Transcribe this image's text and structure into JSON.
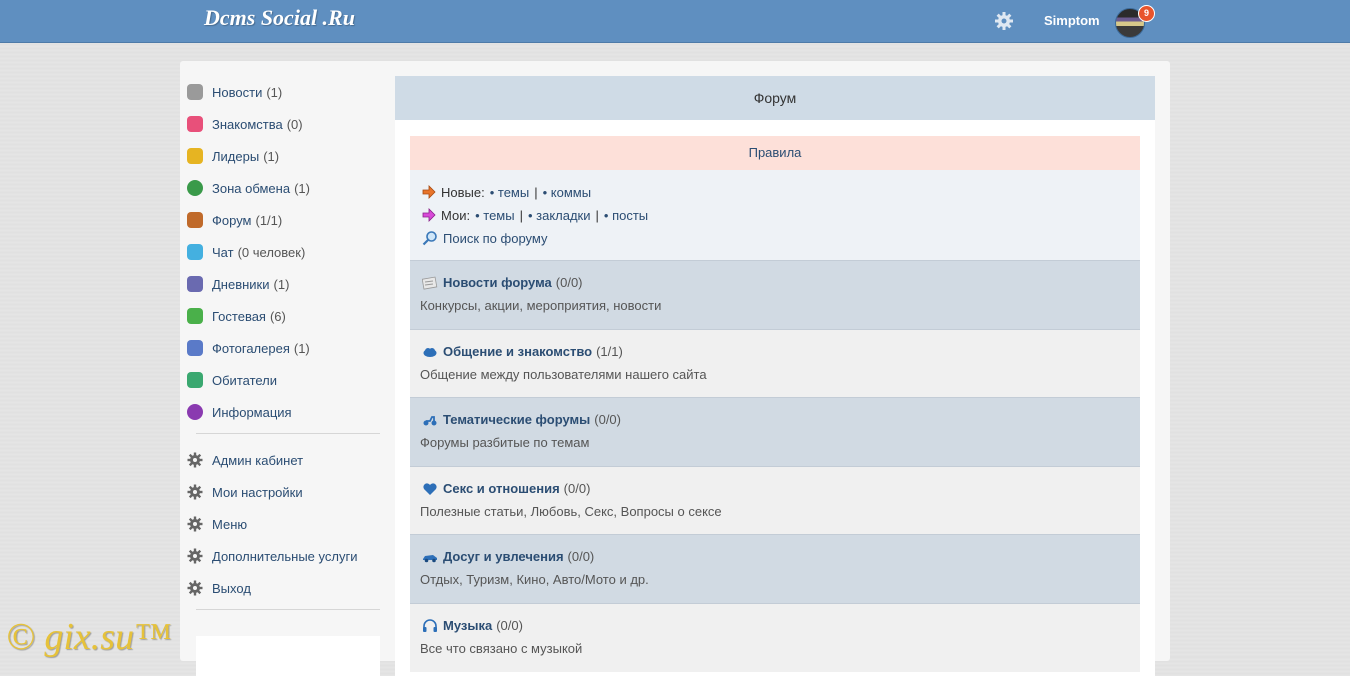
{
  "header": {
    "logo": "Dcms Social .Ru",
    "username": "Simptom",
    "notification_count": "9"
  },
  "sidebar": {
    "items": [
      {
        "label": "Новости",
        "count": "(1)",
        "icon": "news-icon",
        "color": "#9a9a9a"
      },
      {
        "label": "Знакомства",
        "count": "(0)",
        "icon": "heart-icon",
        "color": "#e8507a"
      },
      {
        "label": "Лидеры",
        "count": "(1)",
        "icon": "trophy-icon",
        "color": "#e6b422"
      },
      {
        "label": "Зона обмена",
        "count": "(1)",
        "icon": "exchange-icon",
        "color": "#3a9a4a"
      },
      {
        "label": "Форум",
        "count": "(1/1)",
        "icon": "forum-icon",
        "color": "#c06a2a"
      },
      {
        "label": "Чат",
        "count": "(0 человек)",
        "icon": "chat-icon",
        "color": "#44b0e0"
      },
      {
        "label": "Дневники",
        "count": "(1)",
        "icon": "diary-icon",
        "color": "#6a6ab0"
      },
      {
        "label": "Гостевая",
        "count": "(6)",
        "icon": "guestbook-icon",
        "color": "#4ab04a"
      },
      {
        "label": "Фотогалерея",
        "count": "(1)",
        "icon": "photo-icon",
        "color": "#5a7ac8"
      },
      {
        "label": "Обитатели",
        "count": "",
        "icon": "users-icon",
        "color": "#3aa870"
      },
      {
        "label": "Информация",
        "count": "",
        "icon": "info-icon",
        "color": "#8a3ab0"
      }
    ],
    "settings": [
      {
        "label": "Админ кабинет"
      },
      {
        "label": "Мои настройки"
      },
      {
        "label": "Меню"
      },
      {
        "label": "Дополнительные услуги"
      },
      {
        "label": "Выход"
      }
    ]
  },
  "forum": {
    "title": "Форум",
    "rules": "Правила",
    "new_label": "Новые:",
    "new_topics": "• темы",
    "new_comments": "• коммы",
    "my_label": "Мои:",
    "my_topics": "• темы",
    "my_bookmarks": "• закладки",
    "my_posts": "• посты",
    "separator": "|",
    "search": "Поиск по форуму",
    "categories": [
      {
        "title": "Новости форума",
        "count": "(0/0)",
        "desc": "Конкурсы, акции, мероприятия, новости",
        "icon": "newspaper-icon"
      },
      {
        "title": "Общение и знакомство",
        "count": "(1/1)",
        "desc": "Общение между пользователями нашего сайта",
        "icon": "cloud-icon"
      },
      {
        "title": "Тематические форумы",
        "count": "(0/0)",
        "desc": "Форумы разбитые по темам",
        "icon": "scooter-icon"
      },
      {
        "title": "Секс и отношения",
        "count": "(0/0)",
        "desc": "Полезные статьи, Любовь, Секс, Вопросы о сексе",
        "icon": "heart-icon"
      },
      {
        "title": "Досуг и увлечения",
        "count": "(0/0)",
        "desc": "Отдых, Туризм, Кино, Авто/Мото и др.",
        "icon": "car-icon"
      },
      {
        "title": "Музыка",
        "count": "(0/0)",
        "desc": "Все что связано с музыкой",
        "icon": "headphones-icon"
      }
    ]
  },
  "watermark": "© gix.su™"
}
